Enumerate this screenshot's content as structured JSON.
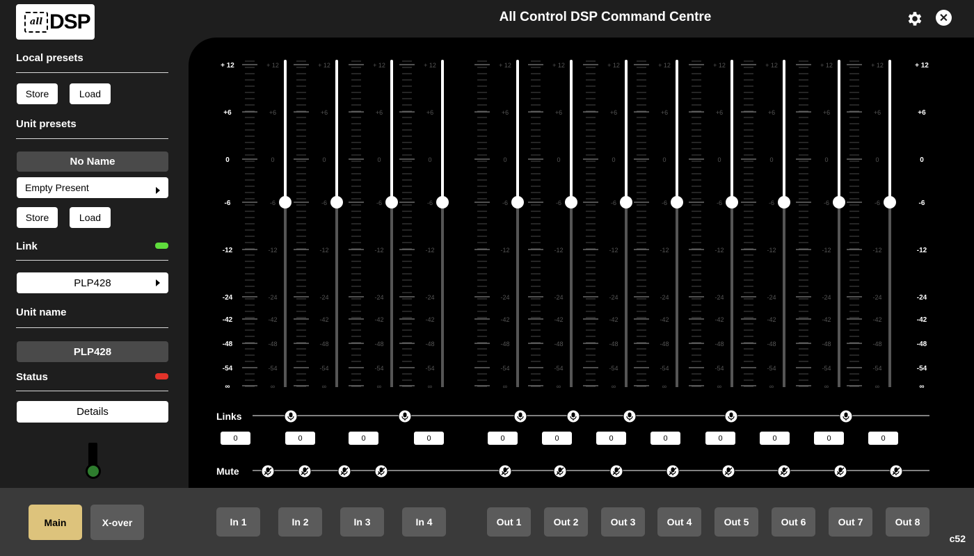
{
  "app": {
    "title": "All Control DSP Command Centre",
    "logo": {
      "chip_text": "all",
      "brand_text": "DSP"
    },
    "version": "c52"
  },
  "sidebar": {
    "local_presets": {
      "label": "Local presets",
      "store": "Store",
      "load": "Load"
    },
    "unit_presets": {
      "label": "Unit presets",
      "name_value": "No Name",
      "preset_select": "Empty Present",
      "store": "Store",
      "load": "Load"
    },
    "link": {
      "label": "Link",
      "led_color": "#5fdc3c",
      "device_select": "PLP428"
    },
    "unit_name": {
      "label": "Unit name",
      "value": "PLP428"
    },
    "status": {
      "label": "Status",
      "led_color": "#e2332a",
      "details": "Details"
    }
  },
  "mixer": {
    "scale_labels": [
      "+ 12",
      "+6",
      "0",
      "-6",
      "-12",
      "-24",
      "-42",
      "-48",
      "-54",
      "∞"
    ],
    "channels": [
      {
        "name": "In 1",
        "level_db": -6,
        "value": "0"
      },
      {
        "name": "In 2",
        "level_db": -6,
        "value": "0"
      },
      {
        "name": "In 3",
        "level_db": -6,
        "value": "0"
      },
      {
        "name": "In 4",
        "level_db": -6,
        "value": "0"
      },
      {
        "name": "Out 1",
        "level_db": -6,
        "value": "0"
      },
      {
        "name": "Out 2",
        "level_db": -6,
        "value": "0"
      },
      {
        "name": "Out 3",
        "level_db": -6,
        "value": "0"
      },
      {
        "name": "Out 4",
        "level_db": -6,
        "value": "0"
      },
      {
        "name": "Out 5",
        "level_db": -6,
        "value": "0"
      },
      {
        "name": "Out 6",
        "level_db": -6,
        "value": "0"
      },
      {
        "name": "Out 7",
        "level_db": -6,
        "value": "0"
      },
      {
        "name": "Out 8",
        "level_db": -6,
        "value": "0"
      }
    ],
    "links_label": "Links",
    "mute_label": "Mute",
    "links_icon": "microphone-icon",
    "mute_icon": "microphone-muted-icon"
  },
  "tabs": {
    "main": "Main",
    "xover": "X-over",
    "accent_color": "#ddc37c",
    "channel_tabs": [
      "In 1",
      "In 2",
      "In 3",
      "In 4",
      "Out 1",
      "Out 2",
      "Out 3",
      "Out 4",
      "Out 5",
      "Out 6",
      "Out 7",
      "Out 8"
    ]
  }
}
